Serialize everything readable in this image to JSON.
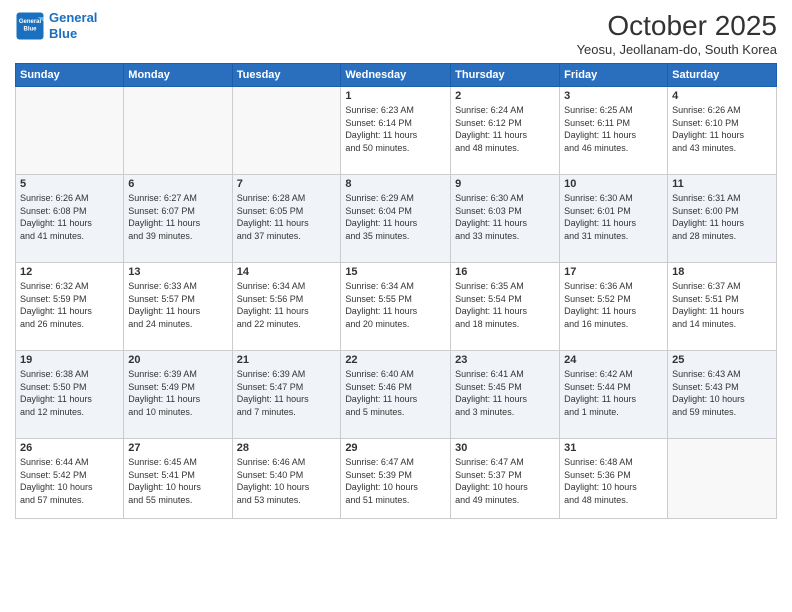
{
  "logo": {
    "line1": "General",
    "line2": "Blue"
  },
  "title": "October 2025",
  "subtitle": "Yeosu, Jeollanam-do, South Korea",
  "weekdays": [
    "Sunday",
    "Monday",
    "Tuesday",
    "Wednesday",
    "Thursday",
    "Friday",
    "Saturday"
  ],
  "weeks": [
    [
      {
        "day": "",
        "info": ""
      },
      {
        "day": "",
        "info": ""
      },
      {
        "day": "",
        "info": ""
      },
      {
        "day": "1",
        "info": "Sunrise: 6:23 AM\nSunset: 6:14 PM\nDaylight: 11 hours\nand 50 minutes."
      },
      {
        "day": "2",
        "info": "Sunrise: 6:24 AM\nSunset: 6:12 PM\nDaylight: 11 hours\nand 48 minutes."
      },
      {
        "day": "3",
        "info": "Sunrise: 6:25 AM\nSunset: 6:11 PM\nDaylight: 11 hours\nand 46 minutes."
      },
      {
        "day": "4",
        "info": "Sunrise: 6:26 AM\nSunset: 6:10 PM\nDaylight: 11 hours\nand 43 minutes."
      }
    ],
    [
      {
        "day": "5",
        "info": "Sunrise: 6:26 AM\nSunset: 6:08 PM\nDaylight: 11 hours\nand 41 minutes."
      },
      {
        "day": "6",
        "info": "Sunrise: 6:27 AM\nSunset: 6:07 PM\nDaylight: 11 hours\nand 39 minutes."
      },
      {
        "day": "7",
        "info": "Sunrise: 6:28 AM\nSunset: 6:05 PM\nDaylight: 11 hours\nand 37 minutes."
      },
      {
        "day": "8",
        "info": "Sunrise: 6:29 AM\nSunset: 6:04 PM\nDaylight: 11 hours\nand 35 minutes."
      },
      {
        "day": "9",
        "info": "Sunrise: 6:30 AM\nSunset: 6:03 PM\nDaylight: 11 hours\nand 33 minutes."
      },
      {
        "day": "10",
        "info": "Sunrise: 6:30 AM\nSunset: 6:01 PM\nDaylight: 11 hours\nand 31 minutes."
      },
      {
        "day": "11",
        "info": "Sunrise: 6:31 AM\nSunset: 6:00 PM\nDaylight: 11 hours\nand 28 minutes."
      }
    ],
    [
      {
        "day": "12",
        "info": "Sunrise: 6:32 AM\nSunset: 5:59 PM\nDaylight: 11 hours\nand 26 minutes."
      },
      {
        "day": "13",
        "info": "Sunrise: 6:33 AM\nSunset: 5:57 PM\nDaylight: 11 hours\nand 24 minutes."
      },
      {
        "day": "14",
        "info": "Sunrise: 6:34 AM\nSunset: 5:56 PM\nDaylight: 11 hours\nand 22 minutes."
      },
      {
        "day": "15",
        "info": "Sunrise: 6:34 AM\nSunset: 5:55 PM\nDaylight: 11 hours\nand 20 minutes."
      },
      {
        "day": "16",
        "info": "Sunrise: 6:35 AM\nSunset: 5:54 PM\nDaylight: 11 hours\nand 18 minutes."
      },
      {
        "day": "17",
        "info": "Sunrise: 6:36 AM\nSunset: 5:52 PM\nDaylight: 11 hours\nand 16 minutes."
      },
      {
        "day": "18",
        "info": "Sunrise: 6:37 AM\nSunset: 5:51 PM\nDaylight: 11 hours\nand 14 minutes."
      }
    ],
    [
      {
        "day": "19",
        "info": "Sunrise: 6:38 AM\nSunset: 5:50 PM\nDaylight: 11 hours\nand 12 minutes."
      },
      {
        "day": "20",
        "info": "Sunrise: 6:39 AM\nSunset: 5:49 PM\nDaylight: 11 hours\nand 10 minutes."
      },
      {
        "day": "21",
        "info": "Sunrise: 6:39 AM\nSunset: 5:47 PM\nDaylight: 11 hours\nand 7 minutes."
      },
      {
        "day": "22",
        "info": "Sunrise: 6:40 AM\nSunset: 5:46 PM\nDaylight: 11 hours\nand 5 minutes."
      },
      {
        "day": "23",
        "info": "Sunrise: 6:41 AM\nSunset: 5:45 PM\nDaylight: 11 hours\nand 3 minutes."
      },
      {
        "day": "24",
        "info": "Sunrise: 6:42 AM\nSunset: 5:44 PM\nDaylight: 11 hours\nand 1 minute."
      },
      {
        "day": "25",
        "info": "Sunrise: 6:43 AM\nSunset: 5:43 PM\nDaylight: 10 hours\nand 59 minutes."
      }
    ],
    [
      {
        "day": "26",
        "info": "Sunrise: 6:44 AM\nSunset: 5:42 PM\nDaylight: 10 hours\nand 57 minutes."
      },
      {
        "day": "27",
        "info": "Sunrise: 6:45 AM\nSunset: 5:41 PM\nDaylight: 10 hours\nand 55 minutes."
      },
      {
        "day": "28",
        "info": "Sunrise: 6:46 AM\nSunset: 5:40 PM\nDaylight: 10 hours\nand 53 minutes."
      },
      {
        "day": "29",
        "info": "Sunrise: 6:47 AM\nSunset: 5:39 PM\nDaylight: 10 hours\nand 51 minutes."
      },
      {
        "day": "30",
        "info": "Sunrise: 6:47 AM\nSunset: 5:37 PM\nDaylight: 10 hours\nand 49 minutes."
      },
      {
        "day": "31",
        "info": "Sunrise: 6:48 AM\nSunset: 5:36 PM\nDaylight: 10 hours\nand 48 minutes."
      },
      {
        "day": "",
        "info": ""
      }
    ]
  ]
}
